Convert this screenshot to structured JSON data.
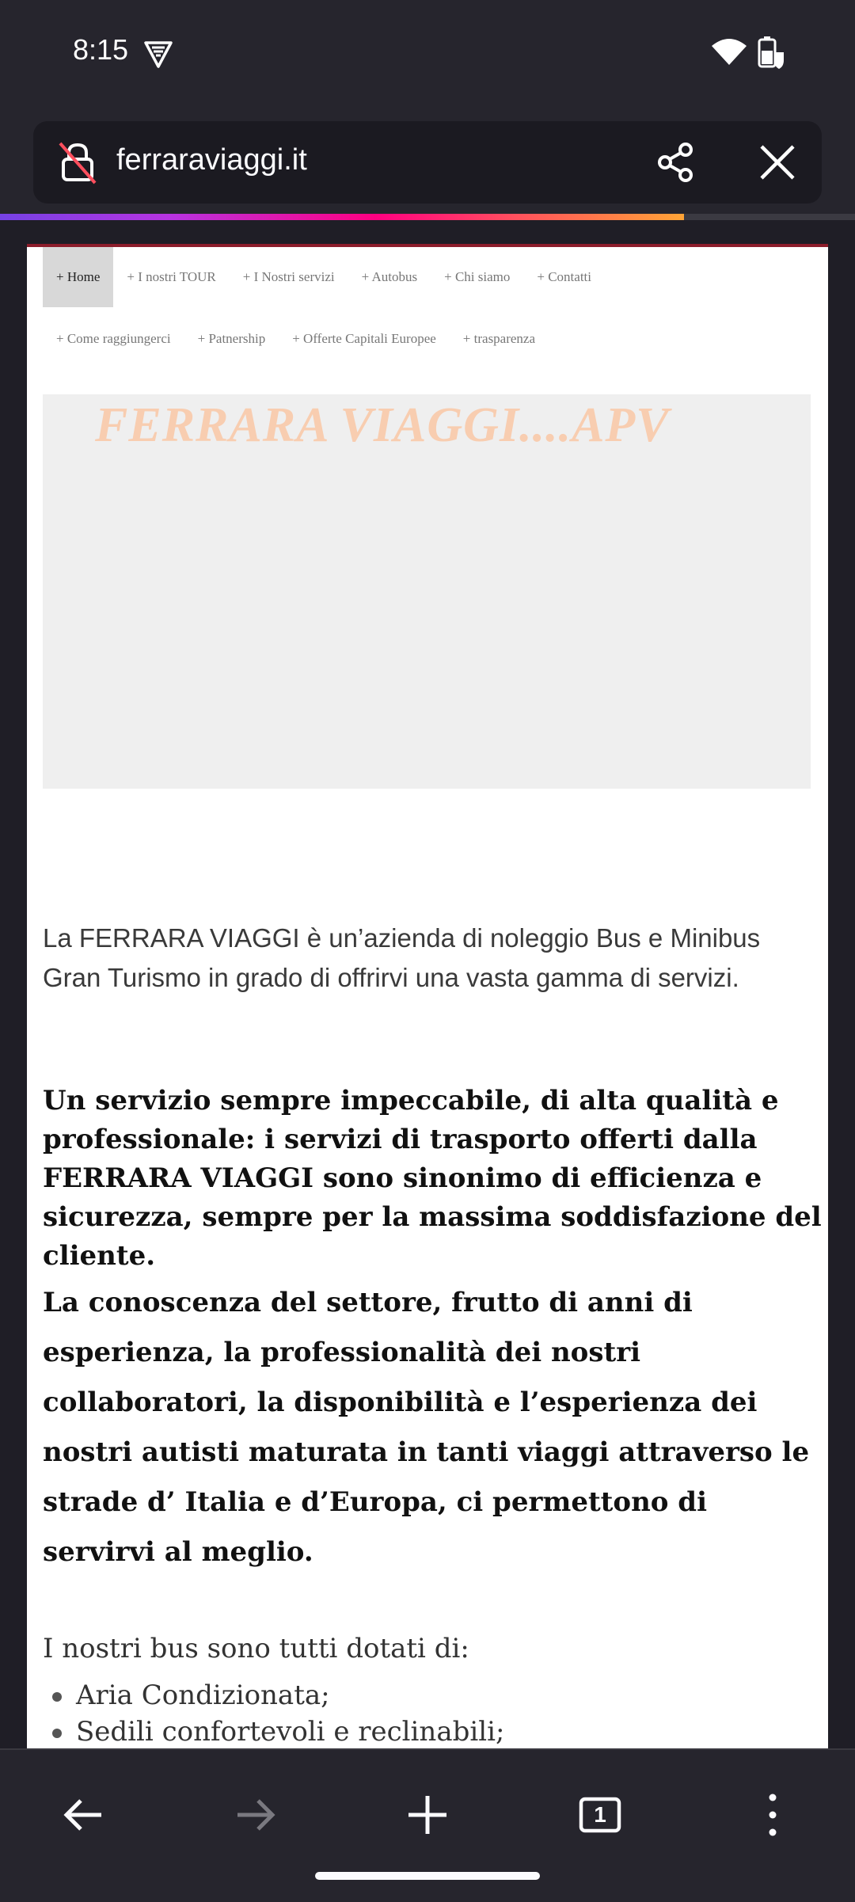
{
  "status_bar": {
    "time": "8:15",
    "icons": [
      "vpn-icon",
      "wifi-icon",
      "battery-icon"
    ]
  },
  "toolbar": {
    "url": "ferraraviaggi.it",
    "icons": [
      "lock-insecure-icon",
      "share-icon",
      "close-icon"
    ],
    "load_progress": 0.8
  },
  "page": {
    "nav_row1": [
      "+ Home",
      "+ I nostri TOUR",
      "+ I Nostri servizi",
      "+ Autobus",
      "+ Chi siamo",
      "+ Contatti"
    ],
    "nav_row2": [
      "+ Come raggiungerci",
      "+ Patnership",
      "+ Offerte Capitali Europee",
      "+ trasparenza"
    ],
    "banner_title": "FERRARA VIAGGI....APV",
    "intro": "La FERRARA VIAGGI è un’azienda di noleggio Bus e Minibus Gran Turismo in grado di offrirvi una vasta gamma di servizi.",
    "bold_paragraph_1": "Un servizio sempre impeccabile, di alta qualità e professionale: i servizi di trasporto offerti dalla FERRARA VIAGGI sono sinonimo di efficienza e sicurezza, sempre per la massima soddisfazione del cliente.",
    "bold_paragraph_2": "La conoscenza del settore, frutto di anni di esperienza, la professionalità dei nostri collaboratori, la disponibilità e l’esperienza dei nostri autisti maturata in tanti viaggi attraverso le strade d’ Italia e d’Europa, ci permettono di servirvi al meglio.",
    "features_title": "I nostri bus sono tutti dotati di:",
    "features": [
      "Aria Condizionata;",
      "Sedili confortevoli  e reclinabili;"
    ]
  },
  "bottom_bar": {
    "tab_count": "1",
    "icons": [
      "back-arrow-icon",
      "forward-arrow-icon",
      "plus-icon",
      "tabs-icon",
      "more-vert-icon"
    ]
  },
  "colors": {
    "chrome_bg": "#26252d",
    "page_accent": "#8c1d2b",
    "banner_text": "#f8cdb0"
  }
}
